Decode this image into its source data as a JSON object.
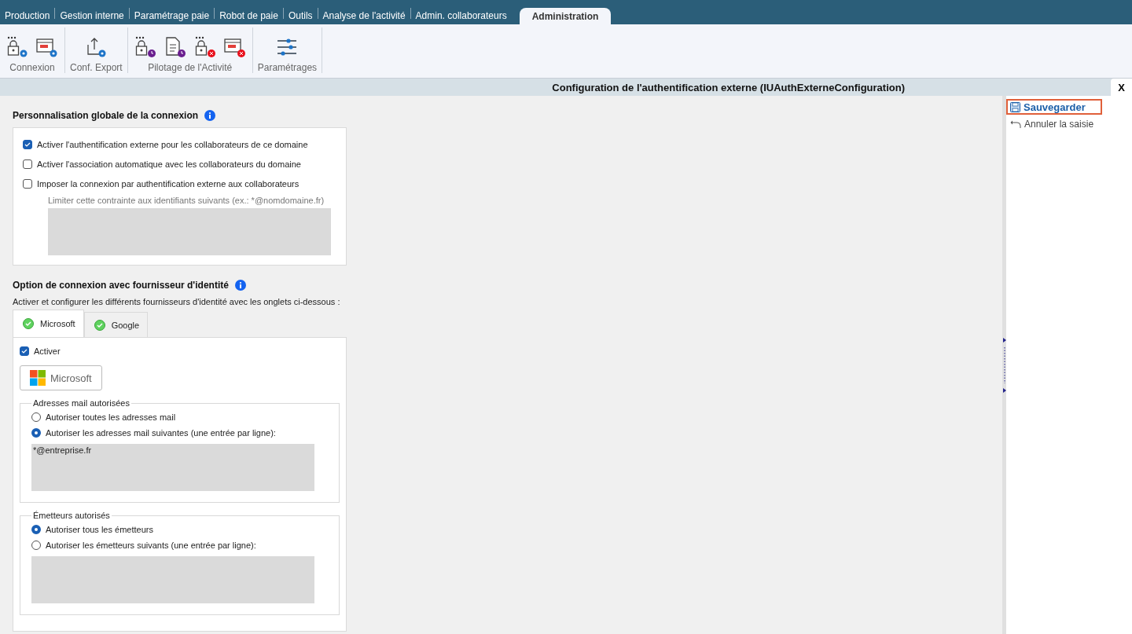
{
  "top_tabs": [
    {
      "label": "Production",
      "selected": false
    },
    {
      "label": "Gestion interne",
      "selected": false
    },
    {
      "label": "Paramétrage paie",
      "selected": false
    },
    {
      "label": "Robot de paie",
      "selected": false
    },
    {
      "label": "Outils",
      "selected": false
    },
    {
      "label": "Analyse de l'activité",
      "selected": false
    },
    {
      "label": "Admin. collaborateurs",
      "selected": false
    },
    {
      "label": "Administration",
      "selected": true
    }
  ],
  "ribbon_groups": [
    {
      "label": "Connexion",
      "buttons": [
        {
          "kind": "lock-gear"
        },
        {
          "kind": "window-gear"
        }
      ]
    },
    {
      "label": "Conf. Export",
      "buttons": [
        {
          "kind": "export-gear"
        }
      ]
    },
    {
      "label": "Pilotage de l'Activité",
      "buttons": [
        {
          "kind": "lock-clock"
        },
        {
          "kind": "document-clock"
        },
        {
          "kind": "lock-error"
        },
        {
          "kind": "window-error"
        }
      ]
    },
    {
      "label": "Paramétrages",
      "buttons": [
        {
          "kind": "sliders"
        }
      ]
    }
  ],
  "panel": {
    "title": "Configuration de l'authentification externe (IUAuthExterneConfiguration)",
    "close": "X"
  },
  "global_section": {
    "title": "Personnalisation globale de la connexion",
    "checkboxes": [
      {
        "label": "Activer l'authentification externe pour les collaborateurs de ce domaine",
        "checked": true
      },
      {
        "label": "Activer l'association automatique avec les collaborateurs du domaine",
        "checked": false
      },
      {
        "label": "Imposer la connexion par authentification externe aux collaborateurs",
        "checked": false
      }
    ],
    "constraint_label": "Limiter cette contrainte aux identifiants suivants (ex.: *@nomdomaine.fr)"
  },
  "provider_section": {
    "title": "Option de connexion avec fournisseur d'identité",
    "description": "Activer et configurer les différents fournisseurs d'identité avec les onglets ci-dessous :",
    "tabs": [
      {
        "label": "Microsoft",
        "selected": true
      },
      {
        "label": "Google",
        "selected": false
      }
    ],
    "enable": {
      "label": "Activer",
      "checked": true
    },
    "provider_button": "Microsoft",
    "fieldsets": [
      {
        "legend": "Adresses mail autorisées",
        "options": [
          {
            "label": "Autoriser toutes les adresses mail",
            "selected": false
          },
          {
            "label": "Autoriser les adresses mail suivantes (une entrée par ligne):",
            "selected": true
          }
        ],
        "value": "*@entreprise.fr"
      },
      {
        "legend": "Émetteurs autorisés",
        "options": [
          {
            "label": "Autoriser tous les émetteurs",
            "selected": true
          },
          {
            "label": "Autoriser les émetteurs suivants (une entrée par ligne):",
            "selected": false
          }
        ]
      }
    ]
  },
  "actions": [
    {
      "kind": "save",
      "label": "Sauvegarder",
      "highlighted": true
    },
    {
      "kind": "undo",
      "label": "Annuler la saisie",
      "highlighted": false
    }
  ]
}
